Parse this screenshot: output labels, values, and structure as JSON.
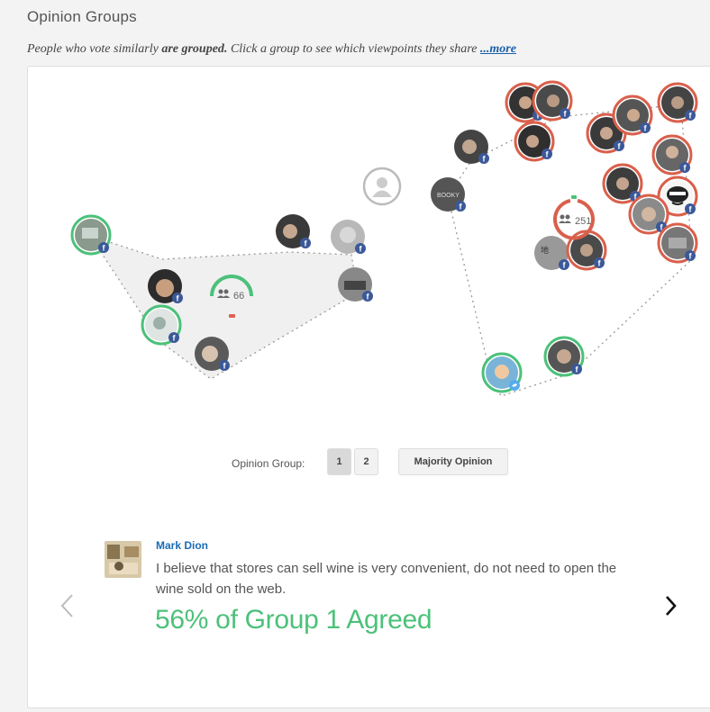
{
  "header": {
    "title": "Opinion Groups"
  },
  "subtitle": {
    "part1": "People who vote similarly ",
    "bold": "are grouped.",
    "part2": " Click a group to see which viewpoints they share ",
    "more_link": "...more"
  },
  "viz": {
    "group1_count": "66",
    "group2_count": "251",
    "group1_color": "#4cc17a",
    "group2_color": "#d9604c"
  },
  "controls": {
    "opinion_group_label": "Opinion Group:",
    "group_buttons": [
      "1",
      "2"
    ],
    "active_group": "1",
    "majority_label": "Majority Opinion"
  },
  "comment": {
    "author": "Mark Dion",
    "text": "I believe that stores can sell wine is very convenient, do not need to open the wine sold on the web.",
    "agree_text": "56% of Group 1 Agreed"
  },
  "icons": {
    "prev": "chevron-left-icon",
    "next": "chevron-right-icon",
    "user": "user-silhouette-icon",
    "people": "people-icon",
    "facebook": "facebook-icon",
    "twitter": "twitter-icon"
  }
}
